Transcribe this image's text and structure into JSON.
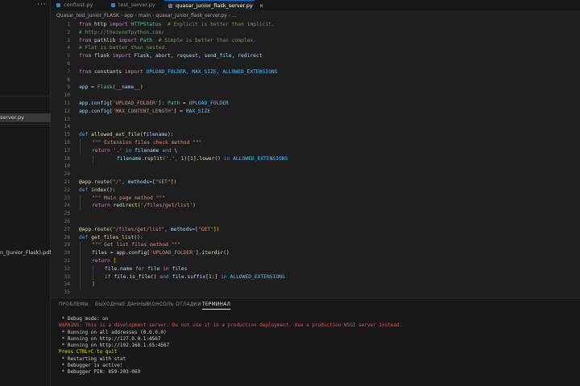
{
  "sidebar": {
    "dots": "···",
    "items": [
      {
        "label": "server.py",
        "active": true
      },
      {
        "label": "n_(Junior_Flask).pdf",
        "active": false
      }
    ]
  },
  "tabs": [
    {
      "label": "conftest.py",
      "active": false
    },
    {
      "label": "test_server.py",
      "active": false
    },
    {
      "label": "quasar_junior_flask_server.py",
      "active": true,
      "close": "×"
    }
  ],
  "breadcrumb": [
    "Quasar_test_junior_FLASK",
    "app",
    "main",
    "quasar_junior_flask_server.py",
    "..."
  ],
  "editor": {
    "line_numbers": [
      "1",
      "2",
      "3",
      "4",
      "5",
      "6",
      "7",
      "8",
      "9",
      "10",
      "11",
      "12",
      "13",
      "14",
      "15",
      "16",
      "17",
      "18",
      "19",
      "20",
      "21",
      "22",
      "23",
      "24",
      "25",
      "26",
      "27",
      "28",
      "29",
      "30",
      "31",
      "32",
      "33",
      "34",
      "35"
    ],
    "lines": {
      "l1": [
        "from",
        "http",
        "import",
        "HTTPStatus",
        "# Explicit is better than implicit."
      ],
      "l2": "# http://thezenofpython.com/",
      "l3": [
        "from",
        "pathlib",
        "import",
        "Path",
        "# Simple is better than complex."
      ],
      "l4": "# Flat is better than nested.",
      "l5": [
        "from",
        "flask",
        "import",
        "Flask, abort, request, send_file, redirect"
      ],
      "l7": [
        "from",
        "constants",
        "import",
        "UPLOAD_FOLDER, MAX_SIZE, ALLOWED_EXTENSIONS"
      ],
      "l9": [
        "app",
        " = ",
        "Flask",
        "(",
        "__name__",
        ")"
      ],
      "l11": [
        "app.config[",
        "'UPLOAD_FOLDER'",
        "]: ",
        "Path",
        " = ",
        "UPLOAD_FOLDER"
      ],
      "l12": [
        "app.config[",
        "'MAX_CONTENT_LENGTH'",
        "] = ",
        "MAX_SIZE"
      ],
      "l15": [
        "def",
        "allowed_ext_file",
        "(filename):"
      ],
      "l16": "\"\"\" Extension files check method \"\"\"",
      "l17": [
        "return",
        "'.'",
        "in",
        "filename",
        "and",
        "\\"
      ],
      "l18": [
        "filename.",
        "rsplit",
        "('.', ",
        "1",
        ")[",
        "1",
        "].",
        "lower",
        "() ",
        "in",
        "ALLOWED_EXTENSIONS"
      ],
      "l21": [
        "@app.route",
        "(",
        "\"/\"",
        ", methods=[",
        "\"GET\"",
        "])"
      ],
      "l22": [
        "def",
        "index",
        "():"
      ],
      "l23": "\"\"\" Main page method \"\"\"",
      "l24": [
        "return",
        "redirect",
        "(",
        "'/files/get/list'",
        ")"
      ],
      "l27": [
        "@app.route",
        "(",
        "\"/files/get/list\"",
        ", methods=[",
        "\"GET\"",
        "])"
      ],
      "l28": [
        "def",
        "get_files_list",
        "():"
      ],
      "l29": "\"\"\" Get list files method \"\"\"",
      "l30": [
        "files",
        " = app.config[",
        "'UPLOAD_FOLDER'",
        "].",
        "iterdir",
        "()"
      ],
      "l31": [
        "return",
        "["
      ],
      "l32": [
        "file",
        ".name",
        "for",
        "file",
        "in",
        "files"
      ],
      "l33": [
        "if",
        "file.",
        "is_file",
        "() ",
        "and",
        "file.suffix[",
        "1",
        ":] ",
        "in",
        "ALLOWED_EXTENSIONS"
      ],
      "l34": "]"
    }
  },
  "panel": {
    "tabs": [
      "ПРОБЛЕМЫ",
      "ВЫХОДНЫЕ ДАННЫЕ",
      "КОНСОЛЬ ОТЛАДКИ",
      "ТЕРМИНАЛ"
    ],
    "active_tab": "ТЕРМИНАЛ",
    "terminal": [
      {
        "text": " * Debug mode: on",
        "kind": "normal"
      },
      {
        "text": "WARNING: This is a development server. Do not use it in a production deployment. Use a production WSGI server instead.",
        "kind": "warn"
      },
      {
        "text": " * Running on all addresses (0.0.0.0)",
        "kind": "normal"
      },
      {
        "text": " * Running on http://127.0.0.1:4567",
        "kind": "normal"
      },
      {
        "text": " * Running on http://192.168.1.65:4567",
        "kind": "normal"
      },
      {
        "text": "Press CTRL+C to quit",
        "kind": "yel"
      },
      {
        "text": " * Restarting with stat",
        "kind": "normal"
      },
      {
        "text": " * Debugger is active!",
        "kind": "normal"
      },
      {
        "text": " * Debugger PIN: 859-203-069",
        "kind": "normal"
      }
    ]
  }
}
